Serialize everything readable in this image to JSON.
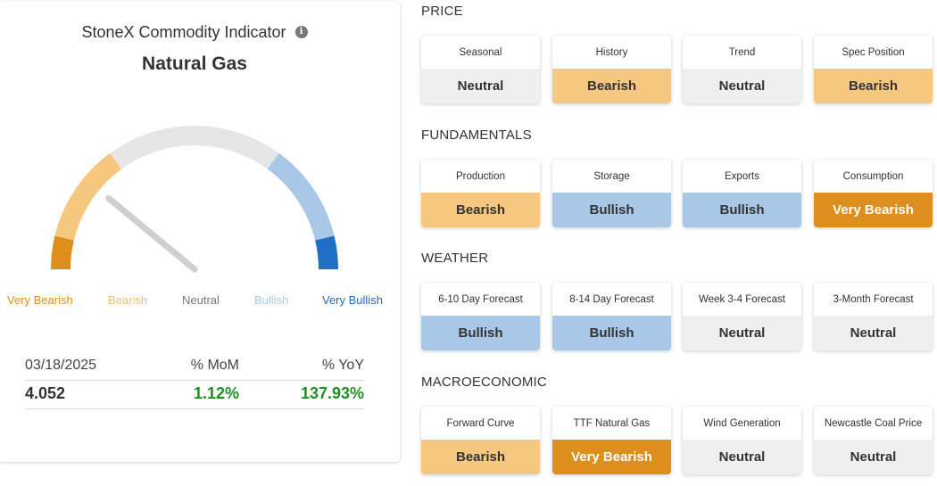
{
  "indicator": {
    "title": "StoneX Commodity Indicator",
    "info_icon": "i",
    "commodity": "Natural Gas",
    "gauge": {
      "value_label": "Neutral",
      "needle_fraction": 0.22,
      "labels": [
        "Very Bearish",
        "Bearish",
        "Neutral",
        "Bullish",
        "Very Bullish"
      ],
      "colors": {
        "very_bearish": "#de8e1d",
        "bearish": "#f6c77e",
        "neutral": "#e6e6e6",
        "bullish": "#a9c8e8",
        "very_bullish": "#1f6fc5"
      }
    },
    "stats": {
      "date": "03/18/2025",
      "mom_label": "% MoM",
      "yoy_label": "% YoY",
      "price": "4.052",
      "mom": "1.12%",
      "yoy": "137.93%"
    }
  },
  "sections": [
    {
      "title": "PRICE",
      "tiles": [
        {
          "label": "Seasonal",
          "value": "Neutral",
          "status": "neutral"
        },
        {
          "label": "History",
          "value": "Bearish",
          "status": "bearish"
        },
        {
          "label": "Trend",
          "value": "Neutral",
          "status": "neutral"
        },
        {
          "label": "Spec Position",
          "value": "Bearish",
          "status": "bearish"
        }
      ]
    },
    {
      "title": "FUNDAMENTALS",
      "tiles": [
        {
          "label": "Production",
          "value": "Bearish",
          "status": "bearish"
        },
        {
          "label": "Storage",
          "value": "Bullish",
          "status": "bullish"
        },
        {
          "label": "Exports",
          "value": "Bullish",
          "status": "bullish"
        },
        {
          "label": "Consumption",
          "value": "Very Bearish",
          "status": "vbearish"
        }
      ]
    },
    {
      "title": "WEATHER",
      "tiles": [
        {
          "label": "6-10 Day Forecast",
          "value": "Bullish",
          "status": "bullish"
        },
        {
          "label": "8-14 Day Forecast",
          "value": "Bullish",
          "status": "bullish"
        },
        {
          "label": "Week 3-4 Forecast",
          "value": "Neutral",
          "status": "neutral"
        },
        {
          "label": "3-Month Forecast",
          "value": "Neutral",
          "status": "neutral"
        }
      ]
    },
    {
      "title": "MACROECONOMIC",
      "tiles": [
        {
          "label": "Forward Curve",
          "value": "Bearish",
          "status": "bearish"
        },
        {
          "label": "TTF Natural Gas",
          "value": "Very Bearish",
          "status": "vbearish"
        },
        {
          "label": "Wind Generation",
          "value": "Neutral",
          "status": "neutral"
        },
        {
          "label": "Newcastle Coal Price",
          "value": "Neutral",
          "status": "neutral"
        }
      ]
    }
  ]
}
